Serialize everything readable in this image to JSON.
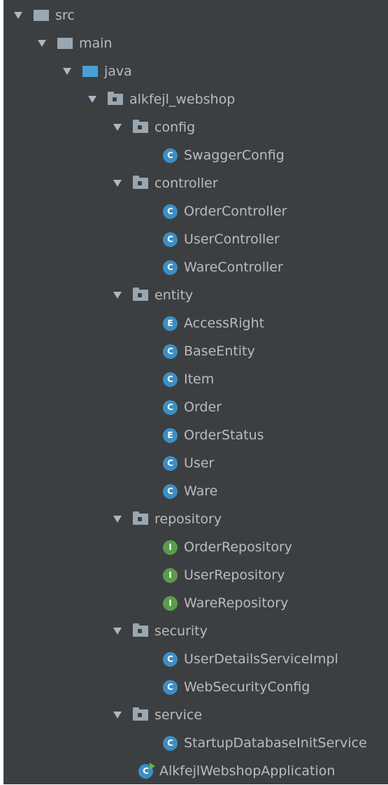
{
  "tree": {
    "src": "src",
    "main": "main",
    "java": "java",
    "package": "alkfejl_webshop",
    "config": {
      "label": "config",
      "items": [
        "SwaggerConfig"
      ]
    },
    "controller": {
      "label": "controller",
      "items": [
        "OrderController",
        "UserController",
        "WareController"
      ]
    },
    "entity": {
      "label": "entity",
      "items": [
        "AccessRight",
        "BaseEntity",
        "Item",
        "Order",
        "OrderStatus",
        "User",
        "Ware"
      ]
    },
    "repository": {
      "label": "repository",
      "items": [
        "OrderRepository",
        "UserRepository",
        "WareRepository"
      ]
    },
    "security": {
      "label": "security",
      "items": [
        "UserDetailsServiceImpl",
        "WebSecurityConfig"
      ]
    },
    "service": {
      "label": "service",
      "items": [
        "StartupDatabaseInitService"
      ]
    },
    "application": "AlkfejlWebshopApplication"
  },
  "badges": {
    "class": "C",
    "enum": "E",
    "interface": "I"
  },
  "icons": {
    "expand": "triangle-down-icon",
    "folder": "folder-icon",
    "source_folder": "source-folder-icon",
    "package": "package-icon",
    "class": "class-icon",
    "enum": "enum-icon",
    "interface": "interface-icon",
    "spring_boot_app": "spring-boot-application-icon"
  },
  "colors": {
    "background": "#3c3f41",
    "text": "#bbbbbb",
    "class_badge": "#3d8ec4",
    "interface_badge": "#5a9b4d",
    "source_folder": "#4a9fd8"
  }
}
